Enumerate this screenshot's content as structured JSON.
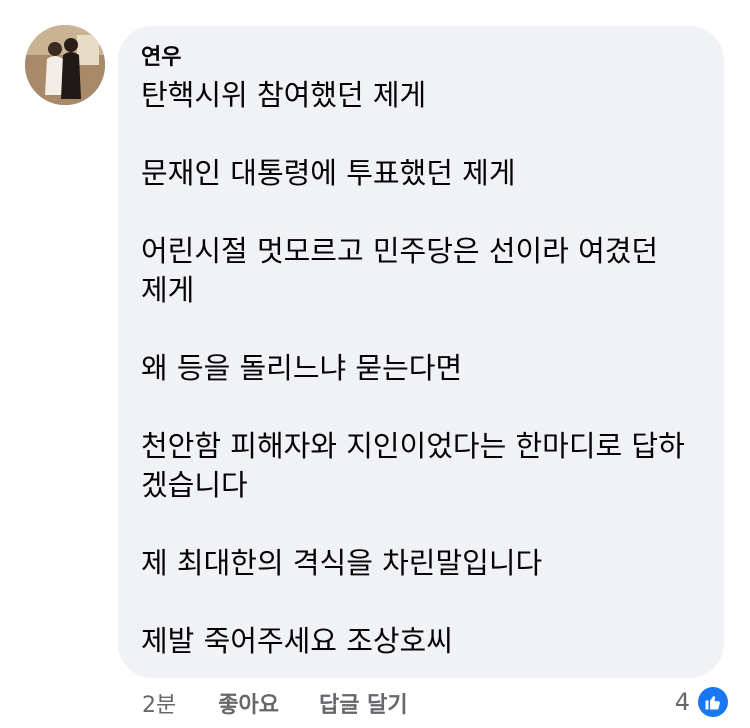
{
  "comment": {
    "author": "연우",
    "paragraphs": [
      "탄핵시위 참여했던 제게",
      "문재인 대통령에 투표했던 제게",
      "어린시절 멋모르고 민주당은 선이라 여겼던\n제게",
      "왜 등을 돌리느냐 묻는다면",
      "천안함 피해자와 지인이었다는 한마디로 답하\n겠습니다",
      "제 최대한의 격식을 차린말입니다",
      "제발 죽어주세요 조상호씨"
    ]
  },
  "actions": {
    "time": "2분",
    "like_label": "좋아요",
    "reply_label": "답글 달기"
  },
  "reaction": {
    "count": "4",
    "icon": "thumbs-up-icon",
    "color": "#1877f2"
  }
}
